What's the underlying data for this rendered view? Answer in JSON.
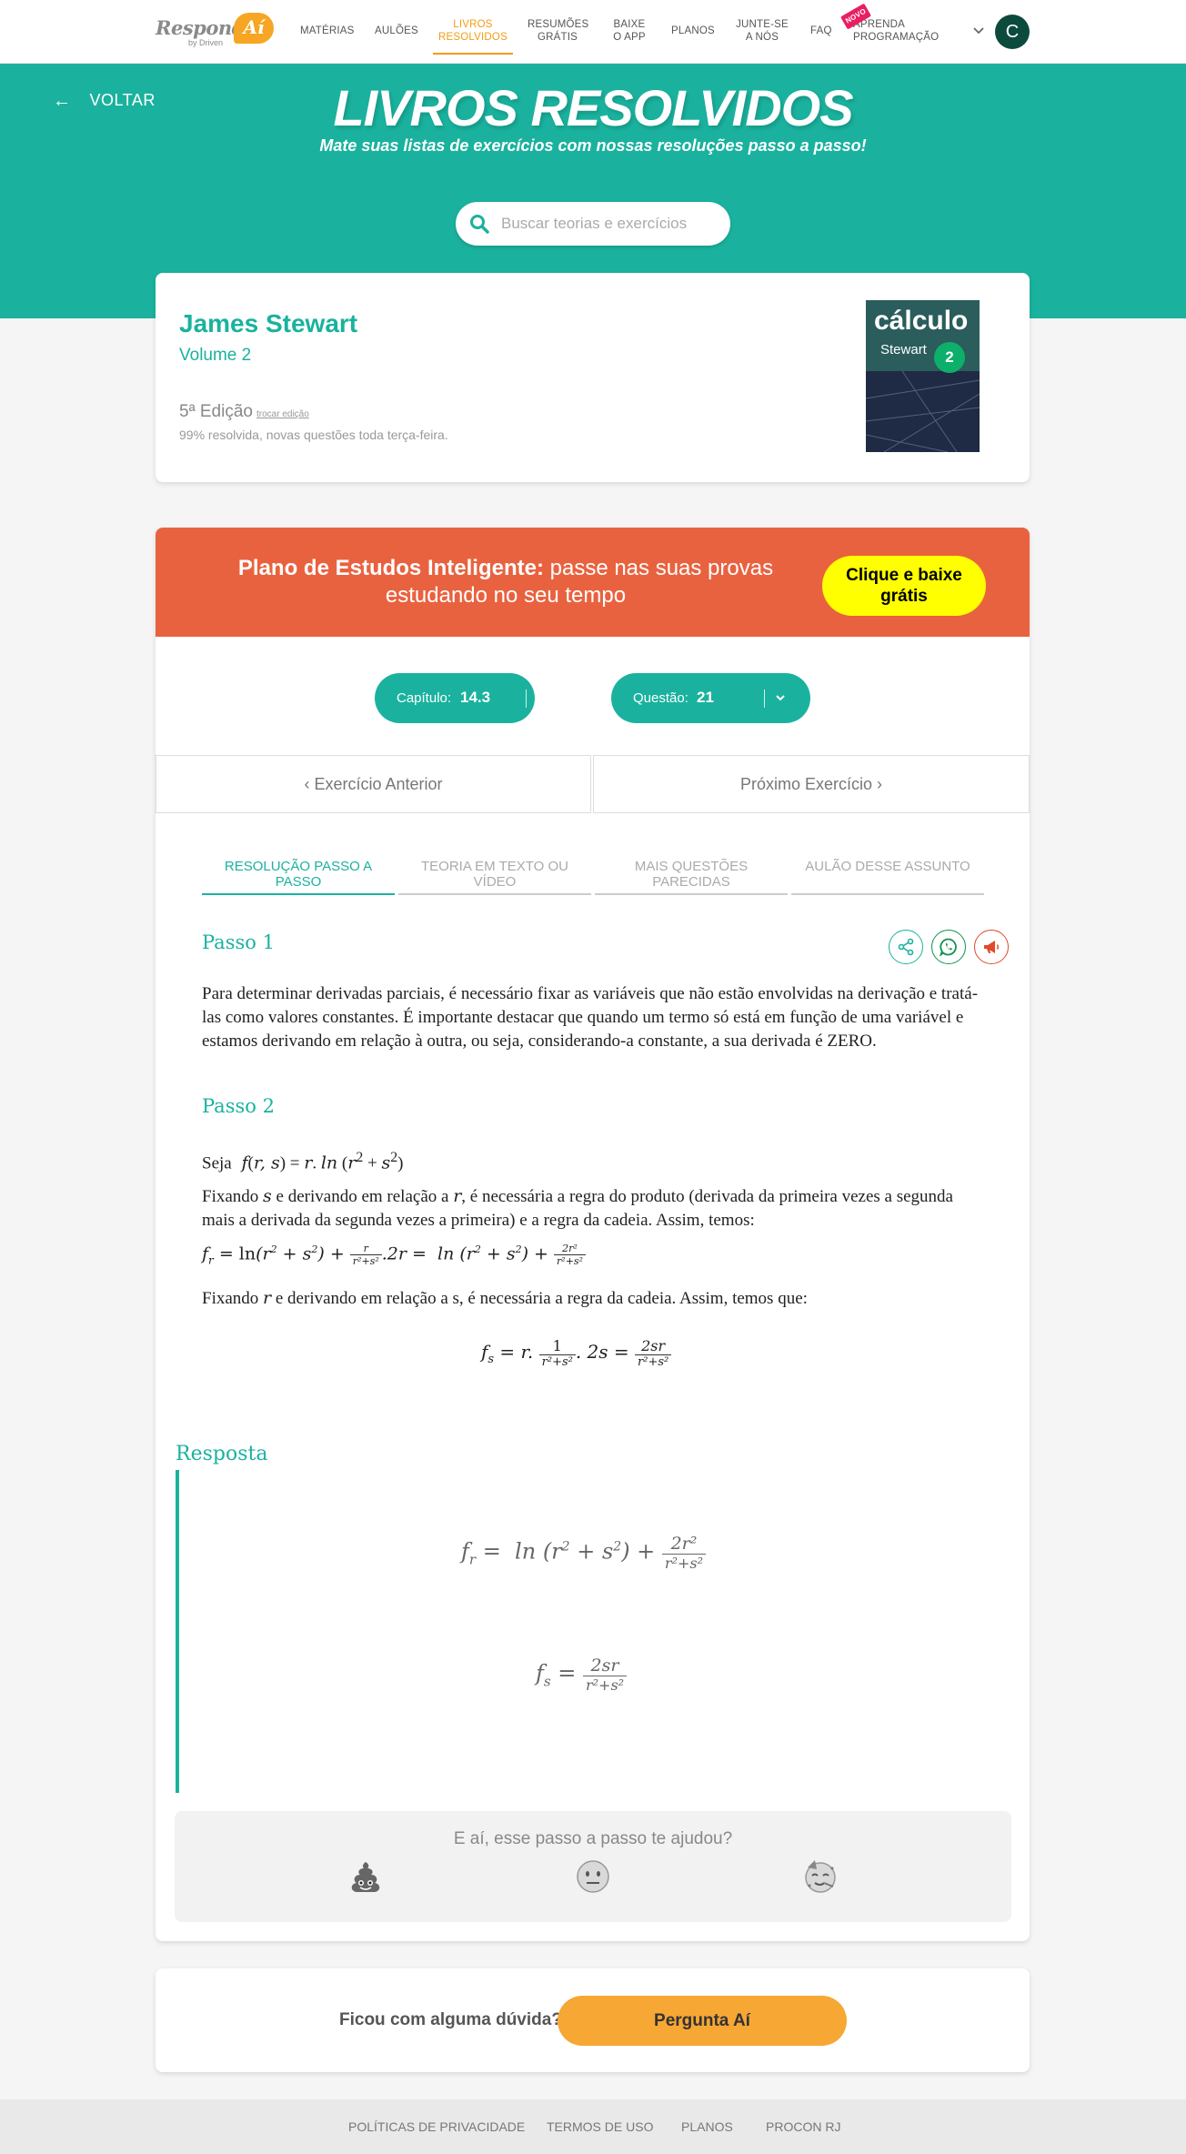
{
  "nav": {
    "logo_word": "Responde",
    "logo_bubble": "Aí",
    "logo_by": "by Driven",
    "items": [
      {
        "label": "MATÉRIAS"
      },
      {
        "label": "AULÕES"
      },
      {
        "label": "LIVROS RESOLVIDOS"
      },
      {
        "label": "RESUMÕES GRÁTIS"
      },
      {
        "label": "BAIXE O APP"
      },
      {
        "label": "PLANOS"
      },
      {
        "label": "JUNTE-SE A NÓS"
      },
      {
        "label": "FAQ"
      },
      {
        "label": "APRENDA PROGRAMAÇÃO",
        "badge": "NOVO"
      }
    ],
    "avatar_letter": "C"
  },
  "hero": {
    "back_label": "VOLTAR",
    "title": "LIVROS RESOLVIDOS",
    "subtitle": "Mate suas listas de exercícios com nossas resoluções passo a passo!",
    "search_placeholder": "Buscar teorias e exercícios"
  },
  "book": {
    "author": "James Stewart",
    "volume": "Volume 2",
    "edition": "5ª Edição",
    "switch_edition": "trocar edição",
    "status": "99% resolvida, novas questões toda terça-feira.",
    "cover_title": "cálculo",
    "cover_author": "Stewart",
    "cover_number": "2"
  },
  "promo": {
    "bold": "Plano de Estudos Inteligente:",
    "text": " passe nas suas provas estudando no seu tempo",
    "cta": "Clique e baixe grátis"
  },
  "selectors": {
    "chapter_label": "Capítulo:",
    "chapter_value": "14.3",
    "question_label": "Questão:",
    "question_value": "21"
  },
  "exercise_nav": {
    "prev": "Exercício Anterior",
    "next": "Próximo Exercício"
  },
  "tabs": [
    {
      "label": "RESOLUÇÃO PASSO A PASSO",
      "active": true
    },
    {
      "label": "TEORIA EM TEXTO OU VÍDEO"
    },
    {
      "label": "MAIS QUESTÕES PARECIDAS"
    },
    {
      "label": "AULÃO DESSE ASSUNTO"
    }
  ],
  "steps": {
    "step1_title": "Passo 1",
    "step1_text": "Para determinar derivadas parciais, é necessário fixar as variáveis que não estão envolvidas na derivação e tratá-las como valores constantes. É importante destacar que quando um termo só está em função de uma variável e estamos derivando em relação à outra, ou seja, considerando-a constante, a sua derivada é ZERO.",
    "step2_title": "Passo 2",
    "seja": "Seja",
    "fix_s_text_a": "Fixando",
    "fix_s_text_b": "e derivando em relação a",
    "fix_s_text_c": ", é necessária a regra do produto (derivada da primeira vezes a segunda mais a derivada da segunda vezes a primeira) e a regra da cadeia. Assim, temos:",
    "fix_r_text_a": "Fixando",
    "fix_r_text_b": "e derivando em relação a s, é necessária a regra da cadeia. Assim, temos que:"
  },
  "resposta": {
    "label": "Resposta"
  },
  "feedback": {
    "question": "E aí, esse passo a passo te ajudou?"
  },
  "ask": {
    "question": "Ficou com alguma dúvida?",
    "button": "Pergunta Aí"
  },
  "footer": {
    "links": [
      "POLÍTICAS DE PRIVACIDADE",
      "TERMOS DE USO",
      "PLANOS",
      "PROCON RJ"
    ]
  },
  "colors": {
    "brand_teal": "#1ab29e",
    "brand_orange": "#f39c12",
    "promo_red": "#e9623f",
    "cta_yellow": "#ffff00",
    "ask_orange": "#f6a734"
  }
}
